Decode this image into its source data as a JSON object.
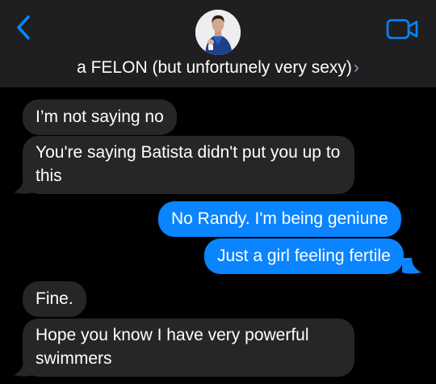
{
  "header": {
    "contact_name": "a FELON (but unfortunely very sexy)",
    "chevron": "›",
    "back_icon": "chevron-left-icon",
    "video_icon": "video-camera-icon",
    "accent": "#0a84ff"
  },
  "messages": [
    {
      "from": "them",
      "text": "I’m not saying no"
    },
    {
      "from": "them",
      "text": "You're saying Batista didn't put you up to this"
    },
    {
      "from": "me",
      "text": "No Randy. I'm being geniune"
    },
    {
      "from": "me",
      "text": "Just a girl feeling fertile"
    },
    {
      "from": "them",
      "text": "Fine."
    },
    {
      "from": "them",
      "text": "Hope you know I have very powerful swimmers"
    }
  ],
  "colors": {
    "incoming_bubble": "#262629",
    "outgoing_bubble": "#0a84ff",
    "header_bg": "#1f1f21",
    "background": "#000000"
  }
}
